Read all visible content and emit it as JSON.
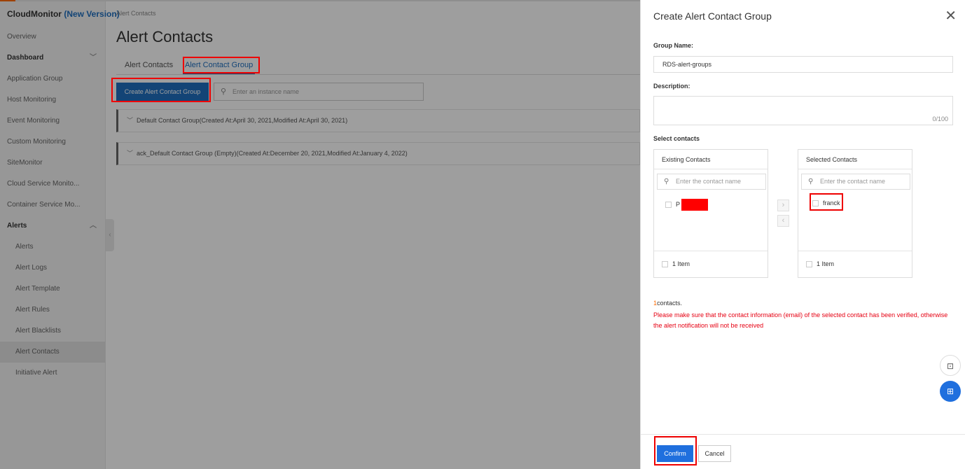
{
  "sidebar": {
    "title": "CloudMonitor",
    "title_version": "(New Version)",
    "items": [
      {
        "label": "Overview"
      },
      {
        "label": "Dashboard"
      },
      {
        "label": "Application Group"
      },
      {
        "label": "Host Monitoring"
      },
      {
        "label": "Event Monitoring"
      },
      {
        "label": "Custom Monitoring"
      },
      {
        "label": "SiteMonitor"
      },
      {
        "label": "Cloud Service Monito..."
      },
      {
        "label": "Container Service Mo..."
      },
      {
        "label": "Alerts"
      },
      {
        "label": "Alerts"
      },
      {
        "label": "Alert Logs"
      },
      {
        "label": "Alert Template"
      },
      {
        "label": "Alert Rules"
      },
      {
        "label": "Alert Blacklists"
      },
      {
        "label": "Alert Contacts"
      },
      {
        "label": "Initiative Alert"
      }
    ]
  },
  "main": {
    "breadcrumb": "Alert Contacts",
    "title": "Alert Contacts",
    "tabs": [
      {
        "label": "Alert Contacts"
      },
      {
        "label": "Alert Contact Group"
      }
    ],
    "create_button": "Create Alert Contact Group",
    "search_placeholder": "Enter an instance name",
    "groups": [
      {
        "label": "Default Contact Group(Created At:April 30, 2021,Modified At:April 30, 2021)"
      },
      {
        "label": "ack_Default Contact Group (Empty)(Created At:December 20, 2021,Modified At:January 4, 2022)"
      }
    ]
  },
  "drawer": {
    "title": "Create Alert Contact Group",
    "group_name_label": "Group Name:",
    "group_name_value": "RDS-alert-groups",
    "description_label": "Description:",
    "description_count": "0/100",
    "select_contacts_label": "Select contacts",
    "existing": {
      "header": "Existing Contacts",
      "search_placeholder": "Enter the contact name",
      "item": "P",
      "footer": "1 Item"
    },
    "selected": {
      "header": "Selected Contacts",
      "search_placeholder": "Enter the contact name",
      "item": "franck",
      "footer": "1 Item"
    },
    "contacts_count": "1",
    "contacts_suffix": "contacts.",
    "warning": "Please make sure that the contact information (email) of the selected contact has been verified, otherwise the alert notification will not be received",
    "confirm": "Confirm",
    "cancel": "Cancel"
  }
}
